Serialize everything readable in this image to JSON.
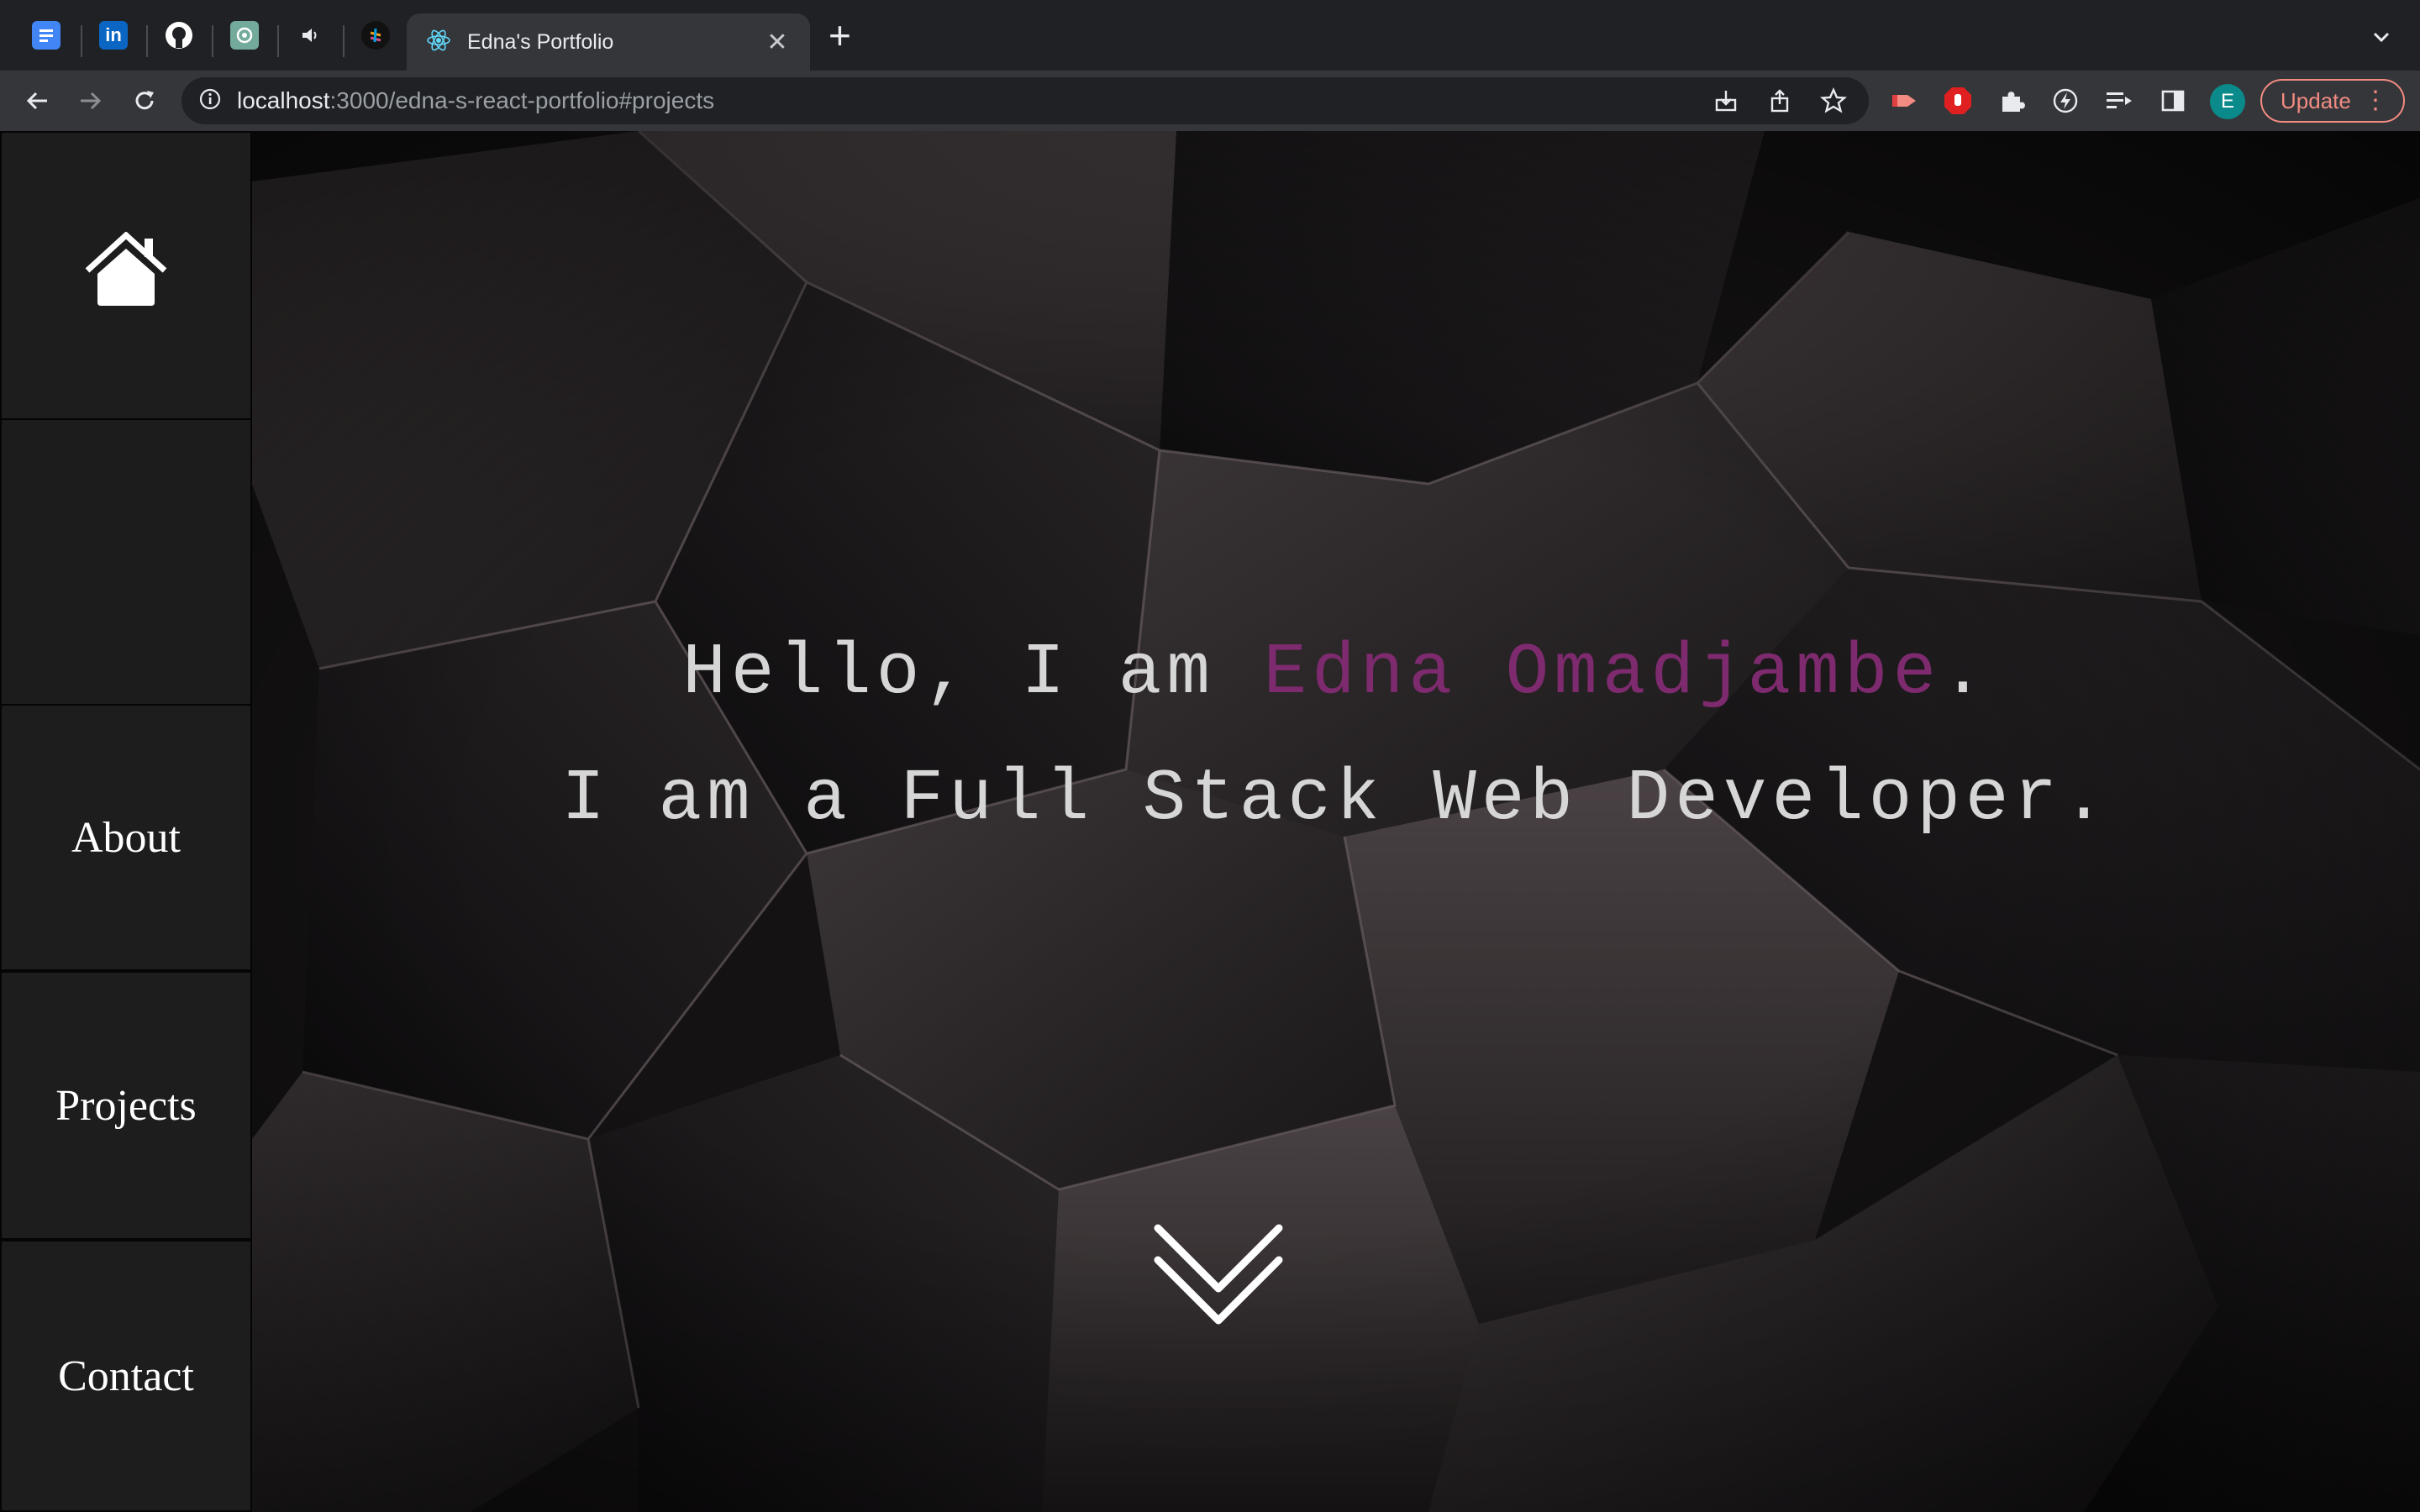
{
  "browser": {
    "active_tab_title": "Edna's Portfolio",
    "tab_close": "✕",
    "new_tab": "+",
    "url_host": "localhost",
    "url_rest": ":3000/edna-s-react-portfolio#projects",
    "profile_initial": "E",
    "update_label": "Update",
    "menu_glyph": "⋮",
    "pinned_tabs": [
      "docs-icon",
      "linkedin-icon",
      "github-icon",
      "chatgpt-icon",
      "audio-icon",
      "sourcegraph-icon"
    ],
    "colors": {
      "tabbar": "#202124",
      "toolbar": "#35363a",
      "update": "#f28b82"
    }
  },
  "sidebar": {
    "home_icon": "home-icon",
    "items": [
      {
        "label": "About"
      },
      {
        "label": "Projects"
      },
      {
        "label": "Contact"
      }
    ]
  },
  "hero": {
    "line1_prefix": "Hello, I am ",
    "name": "Edna Omadjambe",
    "line1_suffix": ".",
    "line2": "I am a Full Stack Web Developer.",
    "name_color": "#7e2a6e",
    "scroll_icon": "double-chevron-down-icon"
  }
}
